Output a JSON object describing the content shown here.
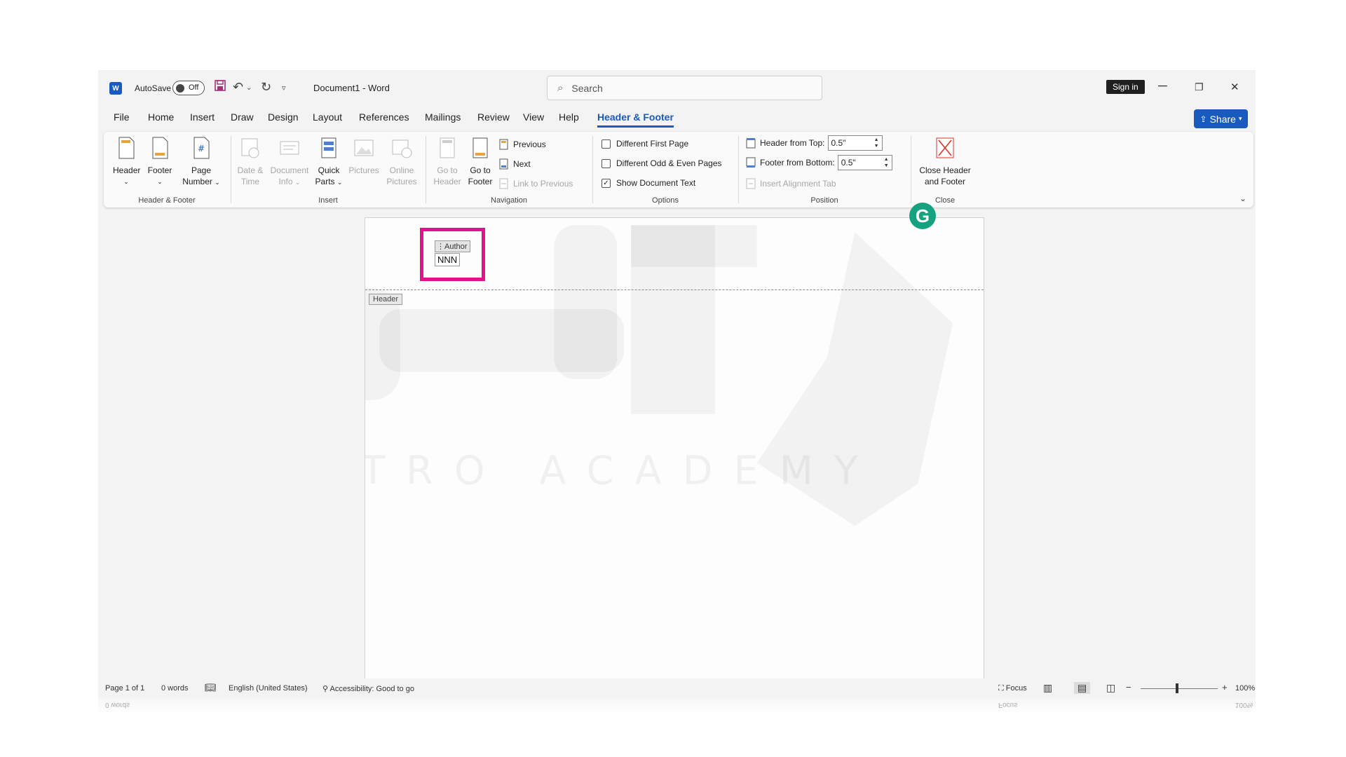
{
  "titlebar": {
    "autosave_label": "AutoSave",
    "autosave_state": "Off",
    "doc_title": "Document1  -  Word",
    "search_placeholder": "Search",
    "signin_label": "Sign in",
    "minimize": "─",
    "restore": "❐",
    "close": "✕"
  },
  "tabs": [
    "File",
    "Home",
    "Insert",
    "Draw",
    "Design",
    "Layout",
    "References",
    "Mailings",
    "Review",
    "View",
    "Help",
    "Header & Footer"
  ],
  "share_label": "Share",
  "ribbon": {
    "header_footer": {
      "label": "Header & Footer",
      "header": "Header",
      "footer": "Footer",
      "page_number_l1": "Page",
      "page_number_l2": "Number"
    },
    "insert": {
      "label": "Insert",
      "date_l1": "Date &",
      "date_l2": "Time",
      "docinfo_l1": "Document",
      "docinfo_l2": "Info",
      "quick_l1": "Quick",
      "quick_l2": "Parts",
      "pictures": "Pictures",
      "online_l1": "Online",
      "online_l2": "Pictures"
    },
    "navigation": {
      "label": "Navigation",
      "goto_header_l1": "Go to",
      "goto_header_l2": "Header",
      "goto_footer_l1": "Go to",
      "goto_footer_l2": "Footer",
      "previous": "Previous",
      "next": "Next",
      "link_previous": "Link to Previous"
    },
    "options": {
      "label": "Options",
      "diff_first": "Different First Page",
      "diff_oddeven": "Different Odd & Even Pages",
      "show_doc_text": "Show Document Text"
    },
    "position": {
      "label": "Position",
      "header_from_top": "Header from Top:",
      "header_value": "0.5\"",
      "footer_from_bottom": "Footer from Bottom:",
      "footer_value": "0.5\"",
      "insert_align_tab": "Insert Alignment Tab"
    },
    "close": {
      "label": "Close",
      "close_l1": "Close Header",
      "close_l2": "and Footer"
    }
  },
  "document": {
    "content_control_title": "Author",
    "content_control_value": "NNN",
    "header_tag": "Header",
    "watermark_text": "ATRO ACADEMY"
  },
  "statusbar": {
    "page": "Page 1 of 1",
    "words": "0 words",
    "language": "English (United States)",
    "accessibility": "Accessibility: Good to go",
    "focus": "Focus",
    "zoom": "100%",
    "reflect_words": "0 words",
    "reflect_focus": "Focus",
    "reflect_zoom": "100%"
  },
  "colors": {
    "accent": "#185abd",
    "highlight": "#e4118c",
    "grammarly": "#15a37f"
  }
}
